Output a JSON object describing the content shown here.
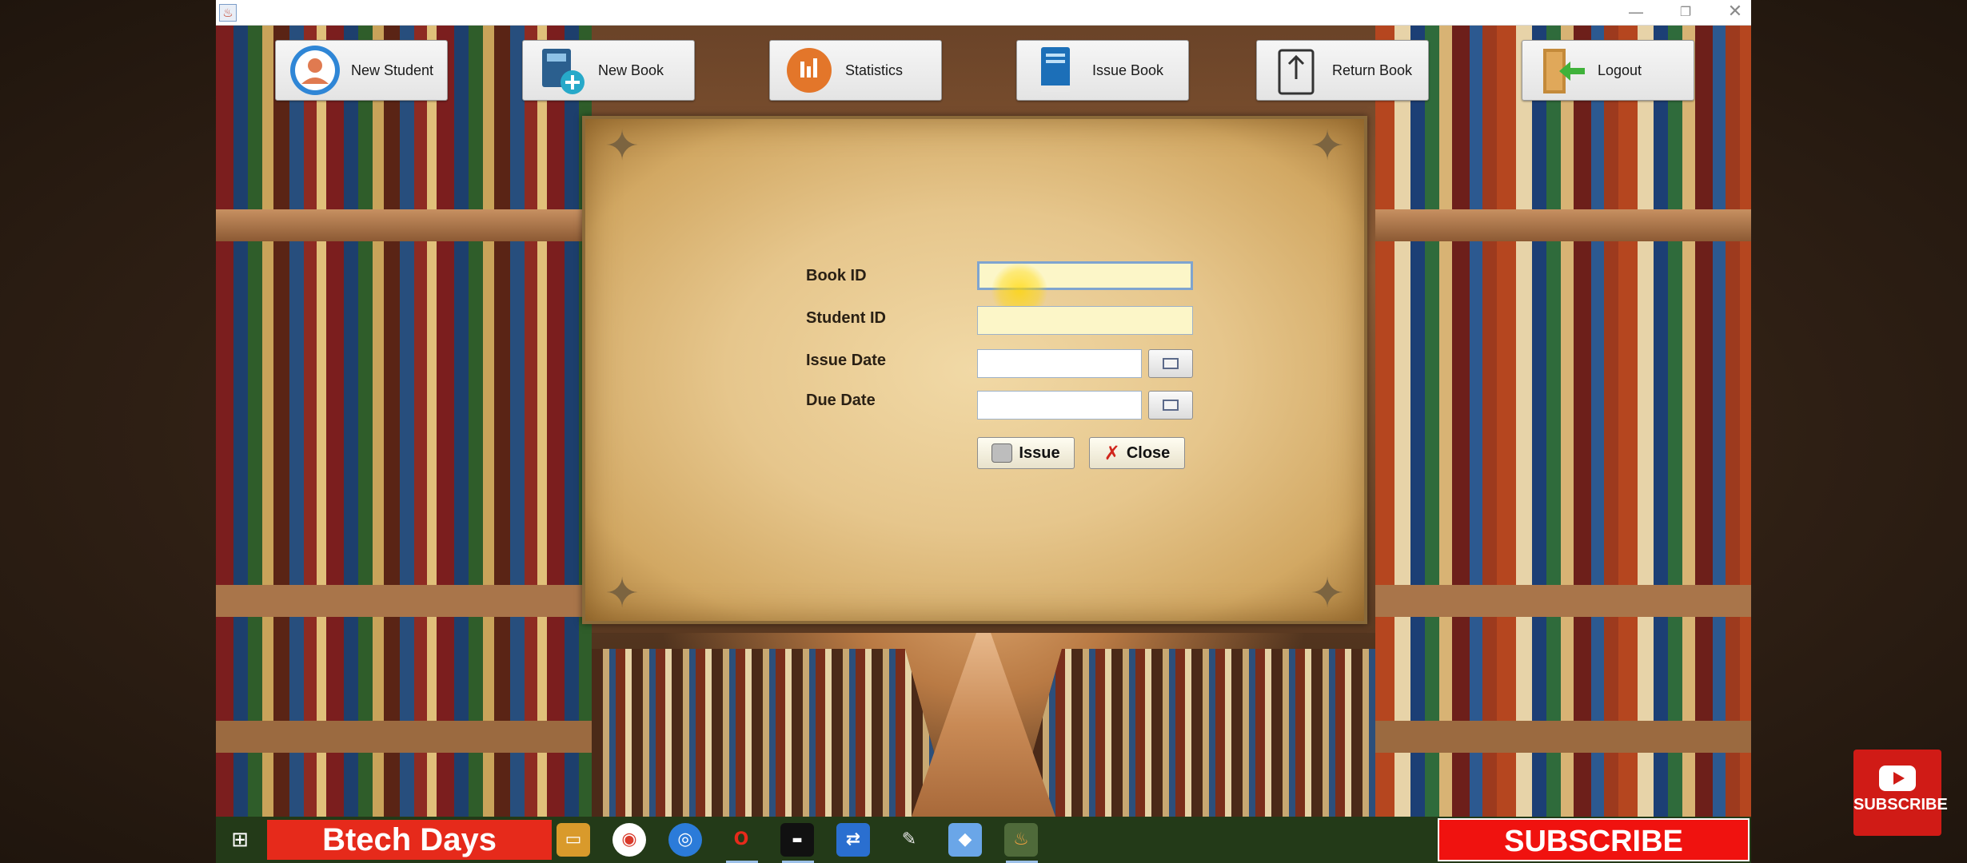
{
  "window": {
    "title_icon": "java-icon",
    "controls": {
      "minimize": "—",
      "maximize": "❐",
      "close": "✕"
    }
  },
  "nav": [
    {
      "label": "New Student",
      "icon": "student-icon"
    },
    {
      "label": "New Book",
      "icon": "new-book-icon"
    },
    {
      "label": "Statistics",
      "icon": "statistics-icon"
    },
    {
      "label": "Issue Book",
      "icon": "issue-book-icon"
    },
    {
      "label": "Return Book",
      "icon": "return-book-icon"
    },
    {
      "label": "Logout",
      "icon": "logout-icon"
    }
  ],
  "form": {
    "book_id_label": "Book ID",
    "book_id_value": "",
    "student_id_label": "Student ID",
    "student_id_value": "",
    "issue_date_label": "Issue Date",
    "issue_date_value": "",
    "due_date_label": "Due Date",
    "due_date_value": "",
    "issue_button": "Issue",
    "close_button": "Close"
  },
  "taskbar": {
    "brand": "Btech Days",
    "subscribe": "SUBSCRIBE",
    "apps": [
      "file-explorer-icon",
      "chrome-icon",
      "network-icon",
      "opera-icon",
      "terminal-icon",
      "remote-desktop-icon",
      "paint-icon",
      "virtualbox-icon",
      "java-app-icon"
    ]
  },
  "youtube_badge": {
    "label": "SUBSCRIBE"
  },
  "colors": {
    "field_yellow": "#fcf6c8",
    "subscribe_red": "#f0120f",
    "brand_red": "#e62a1b",
    "taskbar_bg": "#233a18"
  }
}
